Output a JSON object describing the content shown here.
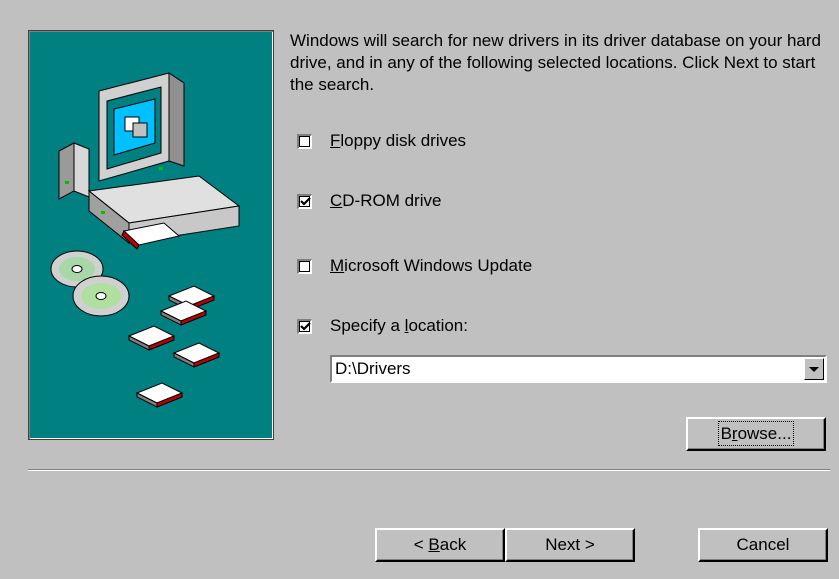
{
  "wizard": {
    "intro_text": "Windows will search for new drivers in its driver database on your hard drive, and in any of the following selected locations. Click Next to start the search.",
    "options": [
      {
        "mnemonic": "F",
        "rest": "loppy disk drives",
        "checked": false
      },
      {
        "mnemonic": "C",
        "rest": "D-ROM drive",
        "checked": true
      },
      {
        "mnemonic": "M",
        "rest": "icrosoft Windows Update",
        "checked": false
      },
      {
        "pre": "Specify a ",
        "mnemonic": "l",
        "rest": "ocation:",
        "checked": true
      }
    ],
    "location_value": "D:\\Drivers",
    "browse": {
      "mnemonic": "r",
      "pre": "B",
      "rest": "owse..."
    },
    "buttons": {
      "back": {
        "pre": "< ",
        "mnemonic": "B",
        "rest": "ack"
      },
      "next": "Next >",
      "cancel": "Cancel"
    }
  },
  "colors": {
    "dialog_bg": "#c0c0c0",
    "art_bg": "#008080"
  },
  "icons": [
    "computer-icon",
    "cd-discs-icon",
    "floppy-disks-icon",
    "dropdown-arrow-icon",
    "checkmark-icon"
  ]
}
